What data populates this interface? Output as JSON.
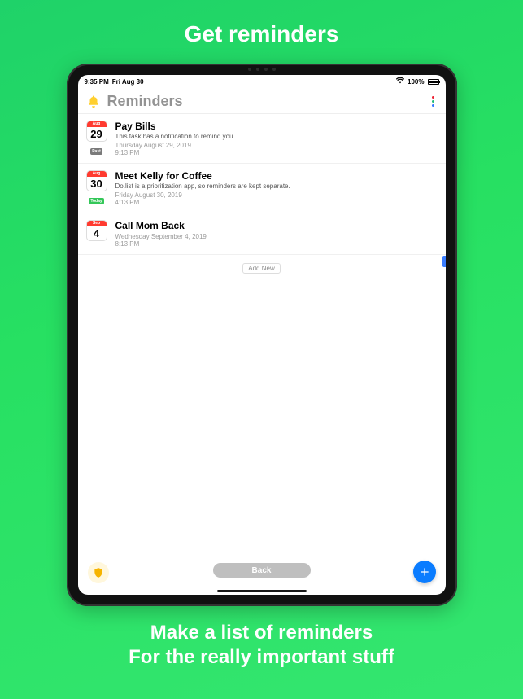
{
  "promo": {
    "top": "Get reminders",
    "bottom_line1": "Make a list of reminders",
    "bottom_line2": "For the really important stuff"
  },
  "status": {
    "time": "9:35 PM",
    "date": "Fri Aug 30",
    "battery_pct": "100%"
  },
  "header": {
    "title": "Reminders"
  },
  "reminders": [
    {
      "month": "Aug",
      "day": "29",
      "tag": "Past",
      "tag_class": "tag-past",
      "title": "Pay Bills",
      "note": "This task has a notification to remind you.",
      "date_line": "Thursday August 29, 2019",
      "time_line": "9:13 PM"
    },
    {
      "month": "Aug",
      "day": "30",
      "tag": "Today",
      "tag_class": "tag-today",
      "title": "Meet Kelly for Coffee",
      "note": "Do.list is a prioritization app, so reminders are kept separate.",
      "date_line": "Friday August 30, 2019",
      "time_line": "4:13 PM"
    },
    {
      "month": "Sep",
      "day": "4",
      "tag": "",
      "tag_class": "",
      "title": "Call Mom Back",
      "note": "",
      "date_line": "Wednesday September 4, 2019",
      "time_line": "8:13 PM"
    }
  ],
  "buttons": {
    "add_new": "Add New",
    "back": "Back"
  },
  "icons": {
    "bell": "bell-icon",
    "more": "more-icon",
    "shield": "shield-icon",
    "add": "plus-icon",
    "wifi": "wifi-icon",
    "battery": "battery-icon"
  },
  "colors": {
    "accent_green": "#27e062",
    "accent_blue": "#0a7cff",
    "cal_red": "#ff3b30"
  }
}
